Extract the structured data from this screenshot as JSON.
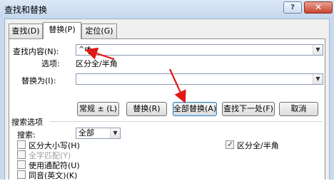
{
  "window": {
    "title": "查找和替换",
    "help_label": "?",
    "close_label": "✕"
  },
  "tabs": [
    {
      "label": "查找(D)"
    },
    {
      "label": "替换(P)"
    },
    {
      "label": "定位(G)"
    }
  ],
  "find": {
    "label": "查找内容(N):",
    "value": "^m",
    "options_label": "选项:",
    "options_value": "区分全/半角"
  },
  "replace": {
    "label": "替换为(I):",
    "value": ""
  },
  "buttons": {
    "more": "常规 ± (L)",
    "replace": "替换(R)",
    "replace_all": "全部替换(A)",
    "find_next": "查找下一处(F)",
    "cancel": "取消"
  },
  "search_options": {
    "header": "搜索选项",
    "search_label": "搜索:",
    "search_value": "全部",
    "options": [
      {
        "label": "区分大小写(H)",
        "checked": false,
        "enabled": true
      },
      {
        "label": "全字匹配(Y)",
        "checked": false,
        "enabled": false
      },
      {
        "label": "使用通配符(U)",
        "checked": false,
        "enabled": true
      },
      {
        "label": "同音(英文)(K)",
        "checked": false,
        "enabled": true
      }
    ],
    "right_option": {
      "label": "区分全/半角",
      "checked": true
    }
  },
  "colors": {
    "annotation_arrow": "#e01818",
    "accent": "#3c7fb1"
  }
}
